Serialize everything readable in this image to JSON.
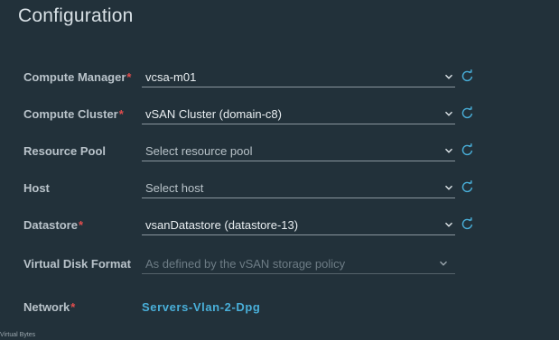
{
  "header": {
    "title": "Configuration"
  },
  "form": {
    "compute_manager": {
      "label": "Compute Manager",
      "required_mark": "*",
      "value": "vcsa-m01"
    },
    "compute_cluster": {
      "label": "Compute Cluster",
      "required_mark": "*",
      "value": "vSAN Cluster (domain-c8)"
    },
    "resource_pool": {
      "label": "Resource Pool",
      "value": "Select resource pool"
    },
    "host": {
      "label": "Host",
      "value": "Select host"
    },
    "datastore": {
      "label": "Datastore",
      "required_mark": "*",
      "value": "vsanDatastore (datastore-13)"
    },
    "virtual_disk_format": {
      "label": "Virtual Disk Format",
      "value": "As defined by the vSAN storage policy",
      "disabled": true
    },
    "network": {
      "label": "Network",
      "required_mark": "*",
      "value": "Servers-Vlan-2-Dpg"
    }
  },
  "icons": {
    "dropdown": "chevron-down-icon",
    "refresh": "refresh-icon"
  },
  "footer": {
    "text": "Virtual Bytes"
  },
  "colors": {
    "background": "#22313a",
    "required": "#e24d4d",
    "link": "#49afd9",
    "refresh_icon": "#49afd9"
  }
}
